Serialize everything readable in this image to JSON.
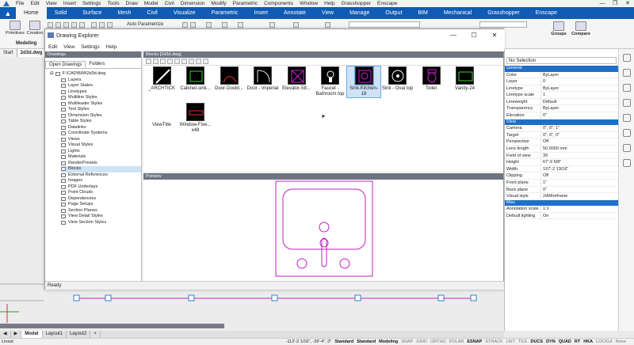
{
  "menubar": {
    "items": [
      "File",
      "Edit",
      "View",
      "Insert",
      "Settings",
      "Tools",
      "Draw",
      "Model",
      "Civil",
      "Dimension",
      "Modify",
      "Parametric",
      "Components",
      "Window",
      "Help",
      "Grasshopper",
      "Enscape"
    ]
  },
  "ribbon_tabs": [
    "Home",
    "Solid",
    "Surface",
    "Mesh",
    "Civil",
    "Visualize",
    "Parametric",
    "Insert",
    "Annotate",
    "View",
    "Manage",
    "Output",
    "BIM",
    "Mechanical",
    "Grasshopper",
    "Enscape"
  ],
  "ribbon": {
    "primitives": "Primitives",
    "creation": "Creation",
    "group_label": "Modeling",
    "auto_param": "Auto Parametrize",
    "groups": "Groups",
    "compare": "Compare"
  },
  "doc_tabs": [
    "Start",
    "2d3d.dwg"
  ],
  "explorer": {
    "title": "Drawing Explorer",
    "menu": [
      "Edit",
      "View",
      "Settings",
      "Help"
    ],
    "left_header": "Drawings",
    "left_tabs": [
      "Open Drawings",
      "Folders"
    ],
    "tree_root": "F:\\CAD\\BIM\\2d3d.dwg",
    "tree": [
      "Layers",
      "Layer States",
      "Linetypes",
      "Multiline Styles",
      "Multileader Styles",
      "Text Styles",
      "Dimension Styles",
      "Table Styles",
      "Datalinks",
      "Coordinate Systems",
      "Views",
      "Visual Styles",
      "Lights",
      "Materials",
      "RenderPresets",
      "Blocks",
      "External References",
      "Images",
      "PDF Underlays",
      "Point Clouds",
      "Dependencies",
      "Page Setups",
      "Section Planes",
      "View Detail Styles",
      "View Section Styles"
    ],
    "selected_tree": "Blocks",
    "blocks_header": "Blocks [2d3d.dwg]",
    "blocks": [
      "_ARCHTICK",
      "Cabinet-sink...",
      "Door-Doubl...",
      "Door - Imperial",
      "Elevator-58...",
      "Faucet - Bathroom top",
      "Sink-Kitchen-18",
      "Sink - Oval top",
      "Toilet",
      "Vanity-24",
      "ViewTitle",
      "Window-Fixe... x48"
    ],
    "selected_block": "Sink-Kitchen-18",
    "preview_header": "Preview",
    "status": "Ready"
  },
  "properties": {
    "selection": "No Selection",
    "sections": {
      "general": "General",
      "view": "View",
      "misc": "Misc"
    },
    "general": [
      [
        "Color",
        "ByLayer"
      ],
      [
        "Layer",
        "0"
      ],
      [
        "Linetype",
        "ByLayer"
      ],
      [
        "Linetype scale",
        "1"
      ],
      [
        "Lineweight",
        "Default"
      ],
      [
        "Transparency",
        "ByLayer"
      ],
      [
        "Elevation",
        "0\""
      ]
    ],
    "view": [
      [
        "Camera",
        "0\", 0\", 1\""
      ],
      [
        "Target",
        "0\", 0\", 0\""
      ],
      [
        "Perspective",
        "Off"
      ],
      [
        "Lens length",
        "50.0000 mm"
      ],
      [
        "Field of view",
        "39"
      ],
      [
        "Height",
        "67'-9 5/8\""
      ],
      [
        "Width",
        "197'-2 13/16\""
      ],
      [
        "Clipping",
        "Off"
      ],
      [
        "Front plane",
        "1\""
      ],
      [
        "Back plane",
        "0\""
      ],
      [
        "Visual style",
        "2dWireframe"
      ]
    ],
    "misc": [
      [
        "Annotation scale",
        "1:1"
      ],
      [
        "Default lighting",
        "On"
      ]
    ]
  },
  "layout_tabs": [
    "Model",
    "Layout1",
    "Layout2"
  ],
  "statusbar": {
    "coords": "-112'-2 1/16\", -39'-4\", 0\"",
    "items": [
      "Standard",
      "Standard",
      "Modeling",
      "SNAP",
      "GRID",
      "ORTHO",
      "POLAR",
      "ESNAP",
      "STRACK",
      "LWT",
      "TILE",
      "DUCS",
      "DYN",
      "QUAD",
      "RT",
      "HKA",
      "LOCKUI",
      "None"
    ],
    "status_left": "Lineal"
  },
  "colors": {
    "accent": "#0f5bb5",
    "selection": "#cfe3f7",
    "preview_stroke": "#c020c0"
  }
}
